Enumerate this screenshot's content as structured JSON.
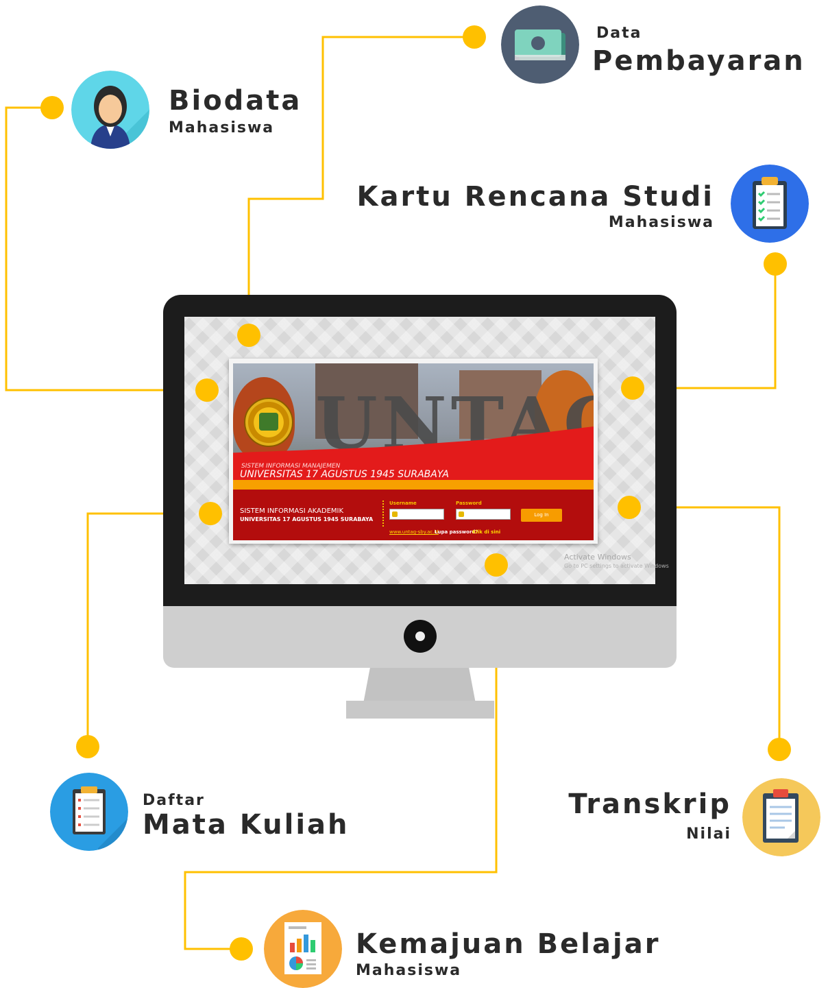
{
  "items": {
    "data_pembayaran": {
      "line1": "Data",
      "line2": "Pembayaran"
    },
    "biodata": {
      "line1": "Biodata",
      "line2": "Mahasiswa"
    },
    "krs": {
      "line1": "Kartu Rencana Studi",
      "line2": "Mahasiswa"
    },
    "daftar_mk": {
      "line1": "Daftar",
      "line2": "Mata Kuliah"
    },
    "transkrip": {
      "line1": "Transkrip",
      "line2": "Nilai"
    },
    "kemajuan": {
      "line1": "Kemajuan Belajar",
      "line2": "Mahasiswa"
    }
  },
  "login_page": {
    "banner_word": "UNTAG",
    "system_small": "SISTEM INFORMASI MANAJEMEN",
    "university_title": "UNIVERSITAS 17 AGUSTUS 1945 SURABAYA",
    "akademik_line1": "SISTEM INFORMASI AKADEMIK",
    "akademik_line2": "UNIVERSITAS 17 AGUSTUS 1945 SURABAYA",
    "username_label": "Username",
    "password_label": "Password",
    "login_button": "Log In",
    "site_link": "www.untag-sby.ac.id",
    "lupa_password": "Lupa password?",
    "klik_disini": "Klik di sini"
  },
  "watermark": {
    "line1": "Activate Windows",
    "line2": "Go to PC settings to activate Windows"
  },
  "colors": {
    "connector": "#FFC000",
    "banner_red": "#E31B1B",
    "login_red": "#B30D0D",
    "accent_orange": "#F7A000"
  }
}
